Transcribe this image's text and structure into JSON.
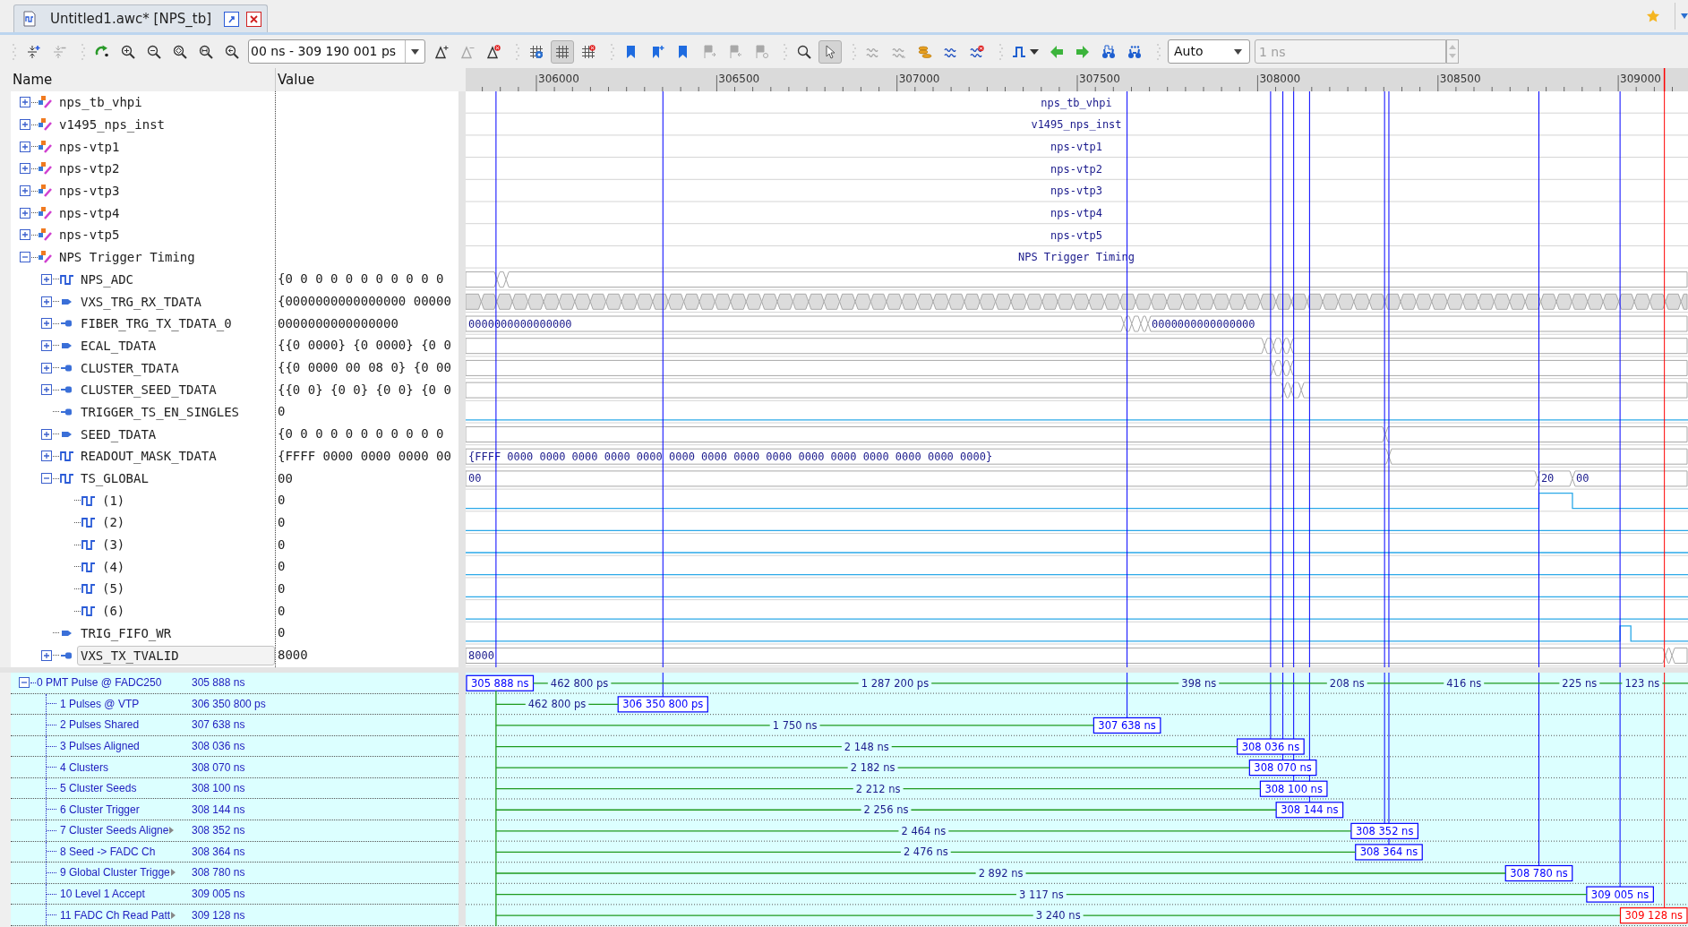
{
  "tab": {
    "title": "Untitled1.awc* [NPS_tb]"
  },
  "toolbar": {
    "groups": [
      [
        {
          "kind": "signal-add",
          "pressed": false,
          "disabled": false
        },
        {
          "kind": "signal-remove",
          "pressed": false,
          "disabled": true
        }
      ],
      [
        {
          "kind": "refresh",
          "pressed": false,
          "disabled": false
        },
        {
          "kind": "zoom-in",
          "pressed": false,
          "disabled": false
        },
        {
          "kind": "zoom-out",
          "pressed": false,
          "disabled": false
        },
        {
          "kind": "zoom-fit",
          "pressed": false,
          "disabled": false
        },
        {
          "kind": "zoom-range",
          "pressed": false,
          "disabled": false
        },
        {
          "kind": "zoom-back",
          "pressed": false,
          "disabled": false
        },
        {
          "kind": "time-range",
          "value": "00 ns - 309 190 001 ps",
          "disabled": false
        },
        {
          "kind": "delta-add",
          "pressed": false,
          "disabled": false
        },
        {
          "kind": "delta-remove",
          "pressed": false,
          "disabled": true
        },
        {
          "kind": "delta-delete",
          "pressed": false,
          "disabled": false
        }
      ],
      [
        {
          "kind": "grid-settings",
          "pressed": false,
          "disabled": false
        },
        {
          "kind": "grid",
          "pressed": true,
          "disabled": false
        },
        {
          "kind": "grid-delete",
          "pressed": false,
          "disabled": false
        }
      ],
      [
        {
          "kind": "bookmark",
          "pressed": false,
          "disabled": false
        },
        {
          "kind": "bookmark-add",
          "pressed": false,
          "disabled": false
        },
        {
          "kind": "bookmark",
          "pressed": false,
          "disabled": false
        },
        {
          "kind": "flag-next",
          "pressed": false,
          "disabled": true
        },
        {
          "kind": "flag-prev",
          "pressed": false,
          "disabled": true
        },
        {
          "kind": "flag-delete",
          "pressed": false,
          "disabled": true
        }
      ],
      [
        {
          "kind": "search",
          "pressed": false,
          "disabled": false
        },
        {
          "kind": "pointer",
          "pressed": true,
          "disabled": false
        }
      ],
      [
        {
          "kind": "wave-a",
          "pressed": false,
          "disabled": true
        },
        {
          "kind": "wave-b",
          "pressed": false,
          "disabled": true
        },
        {
          "kind": "wave-stack",
          "pressed": false,
          "disabled": false
        },
        {
          "kind": "wave-compare",
          "pressed": false,
          "disabled": false
        },
        {
          "kind": "wave-delete",
          "pressed": false,
          "disabled": false
        }
      ],
      [
        {
          "kind": "pulse-menu",
          "pressed": false,
          "disabled": false
        },
        {
          "kind": "arrow-left",
          "pressed": false,
          "disabled": false
        },
        {
          "kind": "arrow-right",
          "pressed": false,
          "disabled": false
        },
        {
          "kind": "find-wave",
          "pressed": false,
          "disabled": false
        },
        {
          "kind": "find-value",
          "pressed": false,
          "disabled": false
        }
      ],
      [
        {
          "kind": "zoom-mode",
          "value": "Auto",
          "disabled": false
        },
        {
          "kind": "step",
          "value": "1 ns",
          "disabled": true
        }
      ]
    ]
  },
  "columns": [
    "Name",
    "Value"
  ],
  "ruler": {
    "ticks": [
      "306000",
      "306500",
      "307000",
      "307500",
      "308000",
      "308500",
      "309000"
    ]
  },
  "signals": [
    {
      "name": "nps_tb_vhpi",
      "kind": "group",
      "expanded": false,
      "selected": false,
      "label": "nps_tb_vhpi"
    },
    {
      "name": "v1495_nps_inst",
      "kind": "group",
      "expanded": false,
      "selected": false,
      "label": "v1495_nps_inst"
    },
    {
      "name": "nps-vtp1",
      "kind": "group",
      "expanded": false,
      "selected": false,
      "label": "nps-vtp1"
    },
    {
      "name": "nps-vtp2",
      "kind": "group",
      "expanded": false,
      "selected": false,
      "label": "nps-vtp2"
    },
    {
      "name": "nps-vtp3",
      "kind": "group",
      "expanded": false,
      "selected": false,
      "label": "nps-vtp3"
    },
    {
      "name": "nps-vtp4",
      "kind": "group",
      "expanded": false,
      "selected": false,
      "label": "nps-vtp4"
    },
    {
      "name": "nps-vtp5",
      "kind": "group",
      "expanded": false,
      "selected": false,
      "label": "nps-vtp5"
    },
    {
      "name": "NPS Trigger Timing",
      "kind": "group",
      "expanded": true,
      "selected": false,
      "label": "NPS Trigger Timing",
      "children": [
        {
          "name": "NPS_ADC",
          "kind": "pulsebus",
          "expanded": false,
          "selected": false,
          "value": "{0 0 0 0 0 0 0 0 0 0 0"
        },
        {
          "name": "VXS_TRG_RX_TDATA",
          "kind": "inbus",
          "expanded": false,
          "selected": false,
          "value": "{0000000000000000 00000"
        },
        {
          "name": "FIBER_TRG_TX_TDATA_0",
          "kind": "outbus",
          "expanded": false,
          "selected": false,
          "value": "0000000000000000",
          "wave": {
            "labels": [
              "0000000000000000",
              "0000000000000000"
            ]
          }
        },
        {
          "name": "ECAL_TDATA",
          "kind": "inbus",
          "expanded": false,
          "selected": false,
          "value": "{{0 0000} {0 0000} {0 0"
        },
        {
          "name": "CLUSTER_TDATA",
          "kind": "outbus",
          "expanded": false,
          "selected": false,
          "value": "{{0 0000 00 08 0} {0 00"
        },
        {
          "name": "CLUSTER_SEED_TDATA",
          "kind": "outbus",
          "expanded": false,
          "selected": false,
          "value": "{{0 0} {0 0} {0 0} {0 0"
        },
        {
          "name": "TRIGGER_TS_EN_SINGLES",
          "kind": "outbit",
          "selected": false,
          "value": "0"
        },
        {
          "name": "SEED_TDATA",
          "kind": "inbus",
          "expanded": false,
          "selected": false,
          "value": "{0 0 0 0 0 0 0 0 0 0 0"
        },
        {
          "name": "READOUT_MASK_TDATA",
          "kind": "pulsebus",
          "expanded": false,
          "selected": false,
          "value": "{FFFF 0000 0000 0000 00",
          "wave": {
            "labels": [
              "{FFFF 0000 0000 0000 0000 0000 0000 0000 0000 0000 0000 0000 0000 0000 0000 0000}"
            ]
          }
        },
        {
          "name": "TS_GLOBAL",
          "kind": "pulsebus",
          "expanded": true,
          "selected": false,
          "value": "00",
          "wave": {
            "labels": [
              "00",
              "20",
              "00"
            ]
          },
          "children": [
            {
              "name": "(1)",
              "kind": "pulsebit",
              "selected": false,
              "value": "0"
            },
            {
              "name": "(2)",
              "kind": "pulsebit",
              "selected": false,
              "value": "0"
            },
            {
              "name": "(3)",
              "kind": "pulsebit",
              "selected": false,
              "value": "0"
            },
            {
              "name": "(4)",
              "kind": "pulsebit",
              "selected": false,
              "value": "0"
            },
            {
              "name": "(5)",
              "kind": "pulsebit",
              "selected": false,
              "value": "0"
            },
            {
              "name": "(6)",
              "kind": "pulsebit",
              "selected": false,
              "value": "0"
            }
          ]
        },
        {
          "name": "TRIG_FIFO_WR",
          "kind": "inbit",
          "selected": false,
          "value": "0"
        },
        {
          "name": "VXS_TX_TVALID",
          "kind": "outbus",
          "expanded": false,
          "selected": true,
          "value": "8000",
          "wave": {
            "labels": [
              "8000"
            ]
          }
        }
      ]
    }
  ],
  "cursors": {
    "name": "0 PMT Pulse @ FADC250",
    "value": "305 888 ns",
    "marker": "305 888 ns",
    "color": "#0000ff",
    "expanded": true,
    "truncated": false,
    "deltas": [
      "462 800 ps",
      "1 287 200 ps",
      "398 ns",
      "208 ns",
      "416 ns",
      "225 ns",
      "123 ns"
    ],
    "children": [
      {
        "name": "1 Pulses @ VTP",
        "value": "306 350 800 ps",
        "marker": "306 350 800 ps",
        "delta": "462 800 ps",
        "color": "#0000ff",
        "truncated": false
      },
      {
        "name": "2 Pulses Shared",
        "value": "307 638 ns",
        "marker": "307 638 ns",
        "delta": "1 750 ns",
        "color": "#0000ff",
        "truncated": false
      },
      {
        "name": "3 Pulses Aligned",
        "value": "308 036 ns",
        "marker": "308 036 ns",
        "delta": "2 148 ns",
        "color": "#0000ff",
        "truncated": false
      },
      {
        "name": "4 Clusters",
        "value": "308 070 ns",
        "marker": "308 070 ns",
        "delta": "2 182 ns",
        "color": "#0000ff",
        "truncated": false
      },
      {
        "name": "5 Cluster Seeds",
        "value": "308 100 ns",
        "marker": "308 100 ns",
        "delta": "2 212 ns",
        "color": "#0000ff",
        "truncated": false
      },
      {
        "name": "6 Cluster Trigger",
        "value": "308 144 ns",
        "marker": "308 144 ns",
        "delta": "2 256 ns",
        "color": "#0000ff",
        "truncated": false
      },
      {
        "name": "7 Cluster Seeds Aligne",
        "value": "308 352 ns",
        "marker": "308 352 ns",
        "delta": "2 464 ns",
        "color": "#0000ff",
        "truncated": true
      },
      {
        "name": "8 Seed -> FADC Ch",
        "value": "308 364 ns",
        "marker": "308 364 ns",
        "delta": "2 476 ns",
        "color": "#0000ff",
        "truncated": false
      },
      {
        "name": "9 Global Cluster Trigge",
        "value": "308 780 ns",
        "marker": "308 780 ns",
        "delta": "2 892 ns",
        "color": "#0000ff",
        "truncated": true
      },
      {
        "name": "10 Level 1 Accept",
        "value": "309 005 ns",
        "marker": "309 005 ns",
        "delta": "3 117 ns",
        "color": "#0000ff",
        "truncated": false
      },
      {
        "name": "11 FADC Ch Read Patt",
        "value": "309 128 ns",
        "marker": "309 128 ns",
        "delta": "3 240 ns",
        "color": "#ff0000",
        "truncated": true
      }
    ]
  }
}
